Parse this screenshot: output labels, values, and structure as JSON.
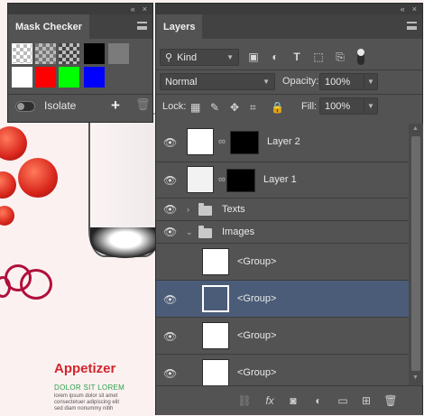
{
  "canvas": {
    "heading": "Appetizer",
    "subheading": "DOLOR SIT LOREM",
    "body_lines": [
      "lorem ipsum dolor sit amet",
      "consectetuer adipiscing elit",
      "sed diam nonummy nibh"
    ]
  },
  "mask_checker": {
    "tab_label": "Mask Checker",
    "isolate_label": "Isolate",
    "swatch_colors": [
      "#ffffff",
      "#ff0000",
      "#00ff00",
      "#0000ff"
    ],
    "gray_swatches": [
      "#000000",
      "#7b7b7b"
    ]
  },
  "layers": {
    "tab_label": "Layers",
    "filter_kind": "Kind",
    "blend_mode": "Normal",
    "opacity_label": "Opacity:",
    "opacity_value": "100%",
    "lock_label": "Lock:",
    "fill_label": "Fill:",
    "fill_value": "100%",
    "items": [
      {
        "name": "Layer 2",
        "type": "layer"
      },
      {
        "name": "Layer 1",
        "type": "layer"
      },
      {
        "name": "Texts",
        "type": "group"
      },
      {
        "name": "Images",
        "type": "group"
      },
      {
        "name": "<Group>",
        "type": "smart"
      },
      {
        "name": "<Group>",
        "type": "smart",
        "selected": true
      },
      {
        "name": "<Group>",
        "type": "smart"
      },
      {
        "name": "<Group>",
        "type": "smart"
      }
    ]
  },
  "colors": {
    "panel_bg": "#535353",
    "selected_row": "#4b5c78",
    "heading_red": "#d2262c",
    "subheading_green": "#2ea04c"
  }
}
